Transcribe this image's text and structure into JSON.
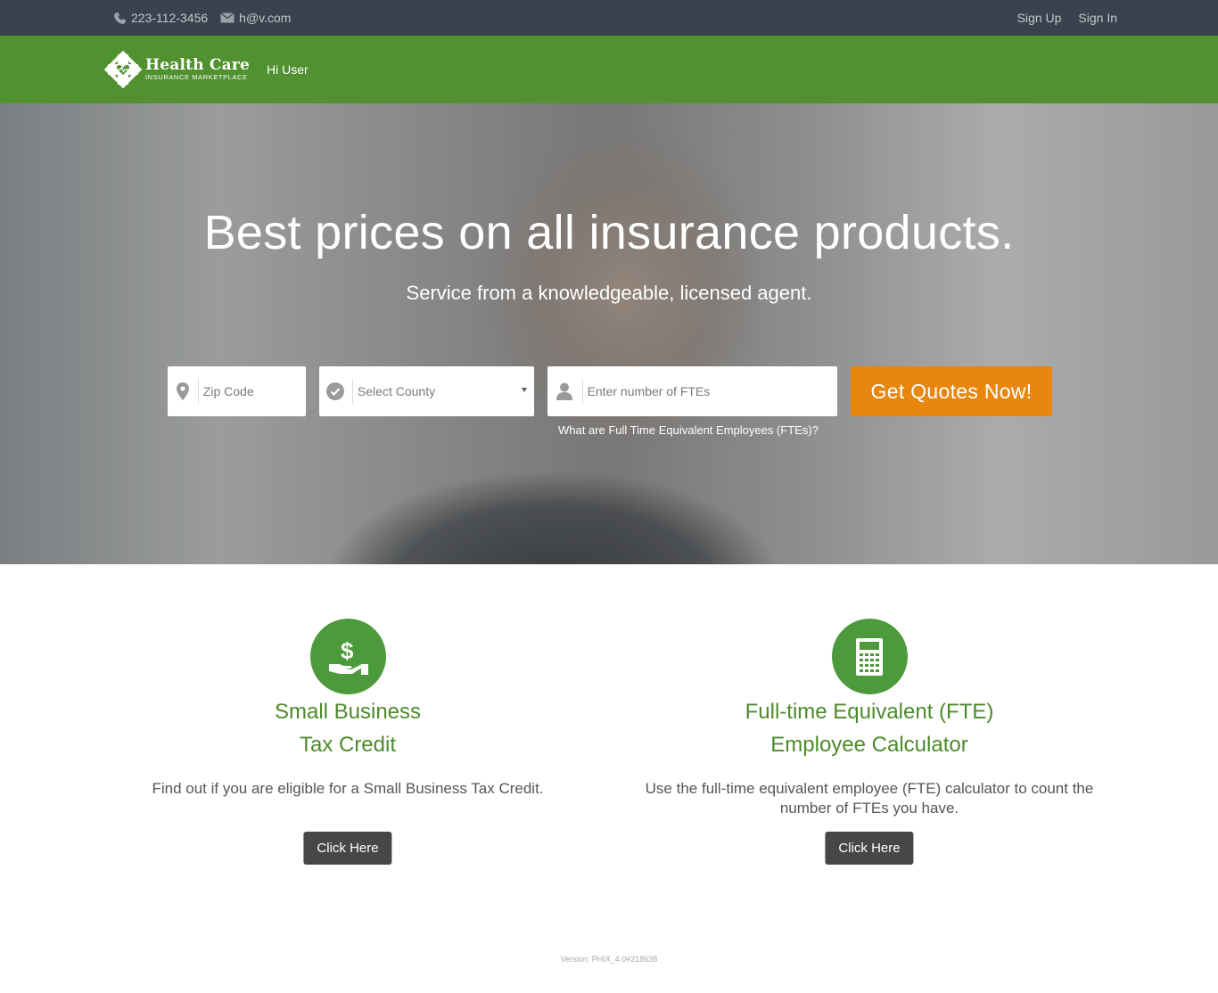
{
  "topbar": {
    "phone": "223-112-3456",
    "email": "h@v.com",
    "sign_up": "Sign Up",
    "sign_in": "Sign In",
    "icons": {
      "phone": "phone-icon",
      "email": "envelope-icon"
    }
  },
  "navbar": {
    "brand_title": "Health Care",
    "brand_subtitle": "INSURANCE MARKETPLACE",
    "greeting": "Hi User",
    "background": "#519130"
  },
  "hero": {
    "headline": "Best prices on all insurance products.",
    "subheadline": "Service from a knowledgeable, licensed agent.",
    "zip_placeholder": "Zip Code",
    "county_selected": "Select County",
    "fte_placeholder": "Enter number of FTEs",
    "cta_label": "Get Quotes Now!",
    "cta_color": "#e8860e",
    "fte_help_link": "What are Full Time Equivalent Employees (FTEs)?"
  },
  "features": [
    {
      "title_line1": "Small Business",
      "title_line2": "Tax Credit",
      "description": "Find out if you are eligible for a Small Business Tax Credit.",
      "button": "Click Here",
      "icon": "money-hand-icon"
    },
    {
      "title_line1": "Full-time Equivalent (FTE)",
      "title_line2": "Employee Calculator",
      "description": "Use the full-time equivalent employee (FTE) calculator to count the number of FTEs you have.",
      "button": "Click Here",
      "icon": "calculator-icon"
    }
  ],
  "footer": {
    "version": "Version: PHIX_4.0#218638"
  }
}
